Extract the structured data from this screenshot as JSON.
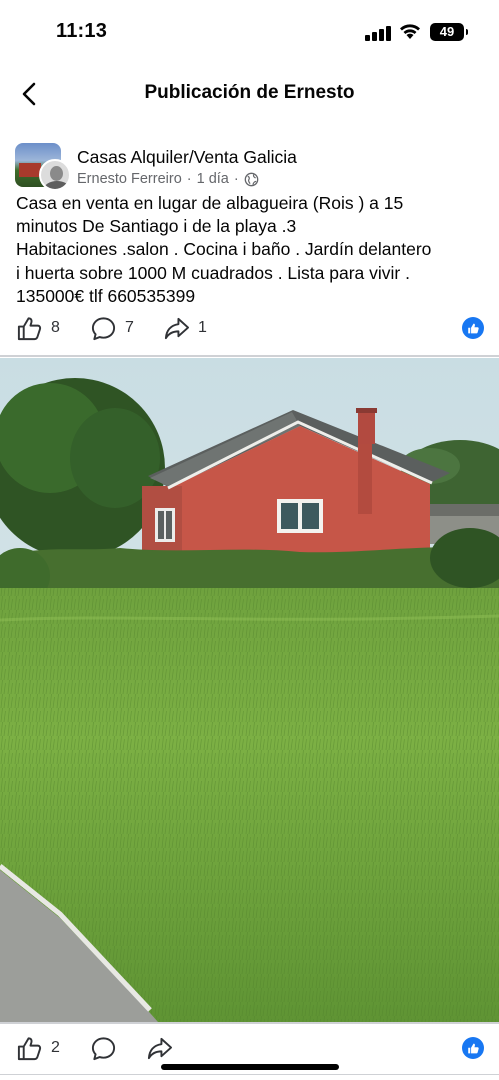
{
  "status_bar": {
    "time": "11:13",
    "battery": "49"
  },
  "header": {
    "title": "Publicación de Ernesto"
  },
  "post": {
    "group_name": "Casas Alquiler/Venta Galicia",
    "author": "Ernesto Ferreiro",
    "separator": "·",
    "time": "1 día",
    "text": "Casa en venta en lugar de albagueira (Rois ) a 15\nminutos De Santiago i de la playa .3\nHabitaciones .salon . Cocina i baño . Jardín delantero\ni huerta sobre 1000 M cuadrados . Lista para vivir .\n135000€ tlf 660535399",
    "likes": "8",
    "comments": "7",
    "shares": "1"
  },
  "photo_actions": {
    "likes": "2"
  },
  "colors": {
    "accent": "#1877f2",
    "secondary_text": "#65676b",
    "divider": "#cfd1d5"
  },
  "icons": [
    "back-chevron-icon",
    "signal-icon",
    "wifi-icon",
    "battery-icon",
    "globe-icon",
    "like-icon",
    "comment-icon",
    "share-icon",
    "like-reaction-icon"
  ]
}
